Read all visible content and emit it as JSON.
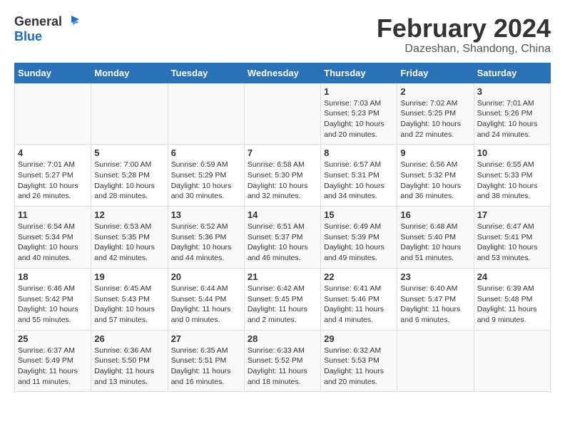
{
  "logo": {
    "line1": "General",
    "line2": "Blue"
  },
  "title": "February 2024",
  "subtitle": "Dazeshan, Shandong, China",
  "weekdays": [
    "Sunday",
    "Monday",
    "Tuesday",
    "Wednesday",
    "Thursday",
    "Friday",
    "Saturday"
  ],
  "weeks": [
    [
      {
        "day": "",
        "info": ""
      },
      {
        "day": "",
        "info": ""
      },
      {
        "day": "",
        "info": ""
      },
      {
        "day": "",
        "info": ""
      },
      {
        "day": "1",
        "sunrise": "Sunrise: 7:03 AM",
        "sunset": "Sunset: 5:23 PM",
        "daylight": "Daylight: 10 hours and 20 minutes."
      },
      {
        "day": "2",
        "sunrise": "Sunrise: 7:02 AM",
        "sunset": "Sunset: 5:25 PM",
        "daylight": "Daylight: 10 hours and 22 minutes."
      },
      {
        "day": "3",
        "sunrise": "Sunrise: 7:01 AM",
        "sunset": "Sunset: 5:26 PM",
        "daylight": "Daylight: 10 hours and 24 minutes."
      }
    ],
    [
      {
        "day": "4",
        "sunrise": "Sunrise: 7:01 AM",
        "sunset": "Sunset: 5:27 PM",
        "daylight": "Daylight: 10 hours and 26 minutes."
      },
      {
        "day": "5",
        "sunrise": "Sunrise: 7:00 AM",
        "sunset": "Sunset: 5:28 PM",
        "daylight": "Daylight: 10 hours and 28 minutes."
      },
      {
        "day": "6",
        "sunrise": "Sunrise: 6:59 AM",
        "sunset": "Sunset: 5:29 PM",
        "daylight": "Daylight: 10 hours and 30 minutes."
      },
      {
        "day": "7",
        "sunrise": "Sunrise: 6:58 AM",
        "sunset": "Sunset: 5:30 PM",
        "daylight": "Daylight: 10 hours and 32 minutes."
      },
      {
        "day": "8",
        "sunrise": "Sunrise: 6:57 AM",
        "sunset": "Sunset: 5:31 PM",
        "daylight": "Daylight: 10 hours and 34 minutes."
      },
      {
        "day": "9",
        "sunrise": "Sunrise: 6:56 AM",
        "sunset": "Sunset: 5:32 PM",
        "daylight": "Daylight: 10 hours and 36 minutes."
      },
      {
        "day": "10",
        "sunrise": "Sunrise: 6:55 AM",
        "sunset": "Sunset: 5:33 PM",
        "daylight": "Daylight: 10 hours and 38 minutes."
      }
    ],
    [
      {
        "day": "11",
        "sunrise": "Sunrise: 6:54 AM",
        "sunset": "Sunset: 5:34 PM",
        "daylight": "Daylight: 10 hours and 40 minutes."
      },
      {
        "day": "12",
        "sunrise": "Sunrise: 6:53 AM",
        "sunset": "Sunset: 5:35 PM",
        "daylight": "Daylight: 10 hours and 42 minutes."
      },
      {
        "day": "13",
        "sunrise": "Sunrise: 6:52 AM",
        "sunset": "Sunset: 5:36 PM",
        "daylight": "Daylight: 10 hours and 44 minutes."
      },
      {
        "day": "14",
        "sunrise": "Sunrise: 6:51 AM",
        "sunset": "Sunset: 5:37 PM",
        "daylight": "Daylight: 10 hours and 46 minutes."
      },
      {
        "day": "15",
        "sunrise": "Sunrise: 6:49 AM",
        "sunset": "Sunset: 5:39 PM",
        "daylight": "Daylight: 10 hours and 49 minutes."
      },
      {
        "day": "16",
        "sunrise": "Sunrise: 6:48 AM",
        "sunset": "Sunset: 5:40 PM",
        "daylight": "Daylight: 10 hours and 51 minutes."
      },
      {
        "day": "17",
        "sunrise": "Sunrise: 6:47 AM",
        "sunset": "Sunset: 5:41 PM",
        "daylight": "Daylight: 10 hours and 53 minutes."
      }
    ],
    [
      {
        "day": "18",
        "sunrise": "Sunrise: 6:46 AM",
        "sunset": "Sunset: 5:42 PM",
        "daylight": "Daylight: 10 hours and 55 minutes."
      },
      {
        "day": "19",
        "sunrise": "Sunrise: 6:45 AM",
        "sunset": "Sunset: 5:43 PM",
        "daylight": "Daylight: 10 hours and 57 minutes."
      },
      {
        "day": "20",
        "sunrise": "Sunrise: 6:44 AM",
        "sunset": "Sunset: 5:44 PM",
        "daylight": "Daylight: 11 hours and 0 minutes."
      },
      {
        "day": "21",
        "sunrise": "Sunrise: 6:42 AM",
        "sunset": "Sunset: 5:45 PM",
        "daylight": "Daylight: 11 hours and 2 minutes."
      },
      {
        "day": "22",
        "sunrise": "Sunrise: 6:41 AM",
        "sunset": "Sunset: 5:46 PM",
        "daylight": "Daylight: 11 hours and 4 minutes."
      },
      {
        "day": "23",
        "sunrise": "Sunrise: 6:40 AM",
        "sunset": "Sunset: 5:47 PM",
        "daylight": "Daylight: 11 hours and 6 minutes."
      },
      {
        "day": "24",
        "sunrise": "Sunrise: 6:39 AM",
        "sunset": "Sunset: 5:48 PM",
        "daylight": "Daylight: 11 hours and 9 minutes."
      }
    ],
    [
      {
        "day": "25",
        "sunrise": "Sunrise: 6:37 AM",
        "sunset": "Sunset: 5:49 PM",
        "daylight": "Daylight: 11 hours and 11 minutes."
      },
      {
        "day": "26",
        "sunrise": "Sunrise: 6:36 AM",
        "sunset": "Sunset: 5:50 PM",
        "daylight": "Daylight: 11 hours and 13 minutes."
      },
      {
        "day": "27",
        "sunrise": "Sunrise: 6:35 AM",
        "sunset": "Sunset: 5:51 PM",
        "daylight": "Daylight: 11 hours and 16 minutes."
      },
      {
        "day": "28",
        "sunrise": "Sunrise: 6:33 AM",
        "sunset": "Sunset: 5:52 PM",
        "daylight": "Daylight: 11 hours and 18 minutes."
      },
      {
        "day": "29",
        "sunrise": "Sunrise: 6:32 AM",
        "sunset": "Sunset: 5:53 PM",
        "daylight": "Daylight: 11 hours and 20 minutes."
      },
      {
        "day": "",
        "info": ""
      },
      {
        "day": "",
        "info": ""
      }
    ]
  ]
}
